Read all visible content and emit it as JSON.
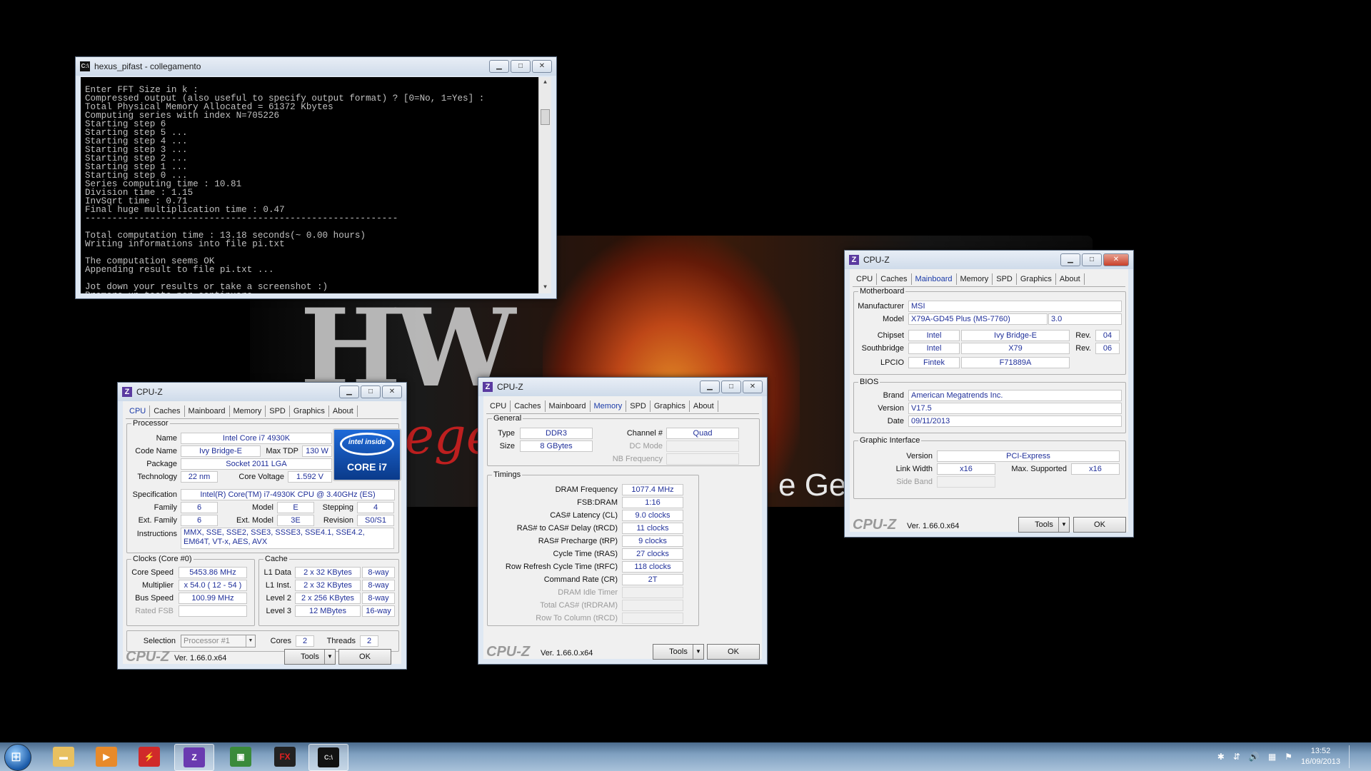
{
  "console": {
    "title": "hexus_pifast - collegamento",
    "lines": [
      "Enter FFT Size in k :",
      "Compressed output (also useful to specify output format) ? [0=No, 1=Yes] :",
      "Total Physical Memory Allocated = 61372 Kbytes",
      "Computing series with index N=705226",
      "Starting step 6",
      "Starting step 5 ...",
      "Starting step 4 ...",
      "Starting step 3 ...",
      "Starting step 2 ...",
      "Starting step 1 ...",
      "Starting step 0 ...",
      "Series computing time : 10.81",
      "Division time : 1.15",
      "InvSqrt time : 0.71",
      "Final huge multiplication time : 0.47",
      "----------------------------------------------------------",
      "",
      "Total computation time : 13.18 seconds(~ 0.00 hours)",
      "Writing informations into file pi.txt",
      "",
      "The computation seems OK",
      "Appending result to file pi.txt ...",
      "",
      "Jot down your results or take a screenshot :)",
      "Premere un tasto per continuare . . ."
    ]
  },
  "wallpaper": {
    "hw": "HW",
    "legend": "Legend",
    "gen": "e Gen"
  },
  "cpuz_common": {
    "title": "CPU-Z",
    "tabs": [
      "CPU",
      "Caches",
      "Mainboard",
      "Memory",
      "SPD",
      "Graphics",
      "About"
    ],
    "logo": "CPU-Z",
    "version": "Ver. 1.66.0.x64",
    "tools": "Tools",
    "ok": "OK"
  },
  "cpu": {
    "processor_title": "Processor",
    "name_l": "Name",
    "name": "Intel Core i7 4930K",
    "codename_l": "Code Name",
    "codename": "Ivy Bridge-E",
    "maxtdp_l": "Max TDP",
    "maxtdp": "130 W",
    "package_l": "Package",
    "package": "Socket 2011 LGA",
    "tech_l": "Technology",
    "tech": "22 nm",
    "cvolt_l": "Core Voltage",
    "cvolt": "1.592 V",
    "spec_l": "Specification",
    "spec": "Intel(R) Core(TM) i7-4930K CPU @ 3.40GHz (ES)",
    "family_l": "Family",
    "family": "6",
    "model_l": "Model",
    "model": "E",
    "stepping_l": "Stepping",
    "stepping": "4",
    "extfamily_l": "Ext. Family",
    "extfamily": "6",
    "extmodel_l": "Ext. Model",
    "extmodel": "3E",
    "revision_l": "Revision",
    "revision": "S0/S1",
    "instr_l": "Instructions",
    "instr": "MMX, SSE, SSE2, SSE3, SSSE3, SSE4.1, SSE4.2, EM64T, VT-x, AES, AVX",
    "intel_badge": {
      "brand": "intel inside",
      "line": "CORE i7"
    },
    "clocks_title": "Clocks (Core #0)",
    "corespeed_l": "Core Speed",
    "corespeed": "5453.86 MHz",
    "mult_l": "Multiplier",
    "mult": "x 54.0 ( 12 - 54 )",
    "bus_l": "Bus Speed",
    "bus": "100.99 MHz",
    "ratedfsb_l": "Rated FSB",
    "ratedfsb": "",
    "cache_title": "Cache",
    "l1d_l": "L1 Data",
    "l1d": "2 x 32 KBytes",
    "l1d_w": "8-way",
    "l1i_l": "L1 Inst.",
    "l1i": "2 x 32 KBytes",
    "l1i_w": "8-way",
    "l2_l": "Level 2",
    "l2": "2 x 256 KBytes",
    "l2_w": "8-way",
    "l3_l": "Level 3",
    "l3": "12 MBytes",
    "l3_w": "16-way",
    "selection_l": "Selection",
    "selection": "Processor #1",
    "cores_l": "Cores",
    "cores": "2",
    "threads_l": "Threads",
    "threads": "2"
  },
  "memory": {
    "general_title": "General",
    "type_l": "Type",
    "type": "DDR3",
    "size_l": "Size",
    "size": "8 GBytes",
    "channel_l": "Channel #",
    "channel": "Quad",
    "dcmode_l": "DC Mode",
    "dcmode": "",
    "nbfreq_l": "NB Frequency",
    "nbfreq": "",
    "timings_title": "Timings",
    "dram_l": "DRAM Frequency",
    "dram": "1077.4 MHz",
    "fsb_l": "FSB:DRAM",
    "fsb": "1:16",
    "cl_l": "CAS# Latency (CL)",
    "cl": "9.0 clocks",
    "trcd_l": "RAS# to CAS# Delay (tRCD)",
    "trcd": "11 clocks",
    "trp_l": "RAS# Precharge (tRP)",
    "trp": "9 clocks",
    "tras_l": "Cycle Time (tRAS)",
    "tras": "27 clocks",
    "trfc_l": "Row Refresh Cycle Time (tRFC)",
    "trfc": "118 clocks",
    "cr_l": "Command Rate (CR)",
    "cr": "2T",
    "idle_l": "DRAM Idle Timer",
    "trdram_l": "Total CAS# (tRDRAM)",
    "trcd2_l": "Row To Column (tRCD)"
  },
  "mainboard": {
    "mb_title": "Motherboard",
    "manuf_l": "Manufacturer",
    "manuf": "MSI",
    "model_l": "Model",
    "model": "X79A-GD45 Plus (MS-7760)",
    "model_rev": "3.0",
    "chipset_l": "Chipset",
    "chipset_v": "Intel",
    "chipset_n": "Ivy Bridge-E",
    "chipset_rev_l": "Rev.",
    "chipset_rev": "04",
    "south_l": "Southbridge",
    "south_v": "Intel",
    "south_n": "X79",
    "south_rev_l": "Rev.",
    "south_rev": "06",
    "lpcio_l": "LPCIO",
    "lpcio_v": "Fintek",
    "lpcio_n": "F71889A",
    "bios_title": "BIOS",
    "brand_l": "Brand",
    "brand": "American Megatrends Inc.",
    "version_l": "Version",
    "version": "V17.5",
    "date_l": "Date",
    "date": "09/11/2013",
    "gi_title": "Graphic Interface",
    "giver_l": "Version",
    "giver": "PCI-Express",
    "lw_l": "Link Width",
    "lw": "x16",
    "maxsup_l": "Max. Supported",
    "maxsup": "x16",
    "sideband_l": "Side Band"
  },
  "taskbar": {
    "items": [
      "explorer-icon",
      "media-player-icon",
      "flash-icon",
      "cpuz-icon",
      "gpu-tool-icon",
      "amd-overdrive-icon",
      "cmd-icon"
    ],
    "amd_label": "FX",
    "cmd_label": "C:\\",
    "time": "13:52",
    "date": "16/09/2013"
  }
}
